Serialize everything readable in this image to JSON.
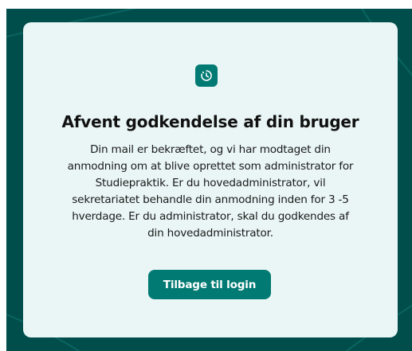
{
  "card": {
    "icon": "clock-pending-icon",
    "title": "Afvent godkendelse af din bruger",
    "body_lines": [
      "Din mail er bekræftet, og vi har modtaget din",
      "anmodning om at blive oprettet som administrator for",
      "Studiepraktik. Er du hovedadministrator, vil",
      "sekretariatet behandle din anmodning inden for 3 -5",
      "hverdage. Er du administrator, skal du godkendes af",
      "din hovedadministrator."
    ],
    "button_label": "Tilbage til login"
  },
  "colors": {
    "background": "#004e4c",
    "card": "#e9f6f5",
    "accent": "#007a72",
    "text": "#111111"
  }
}
